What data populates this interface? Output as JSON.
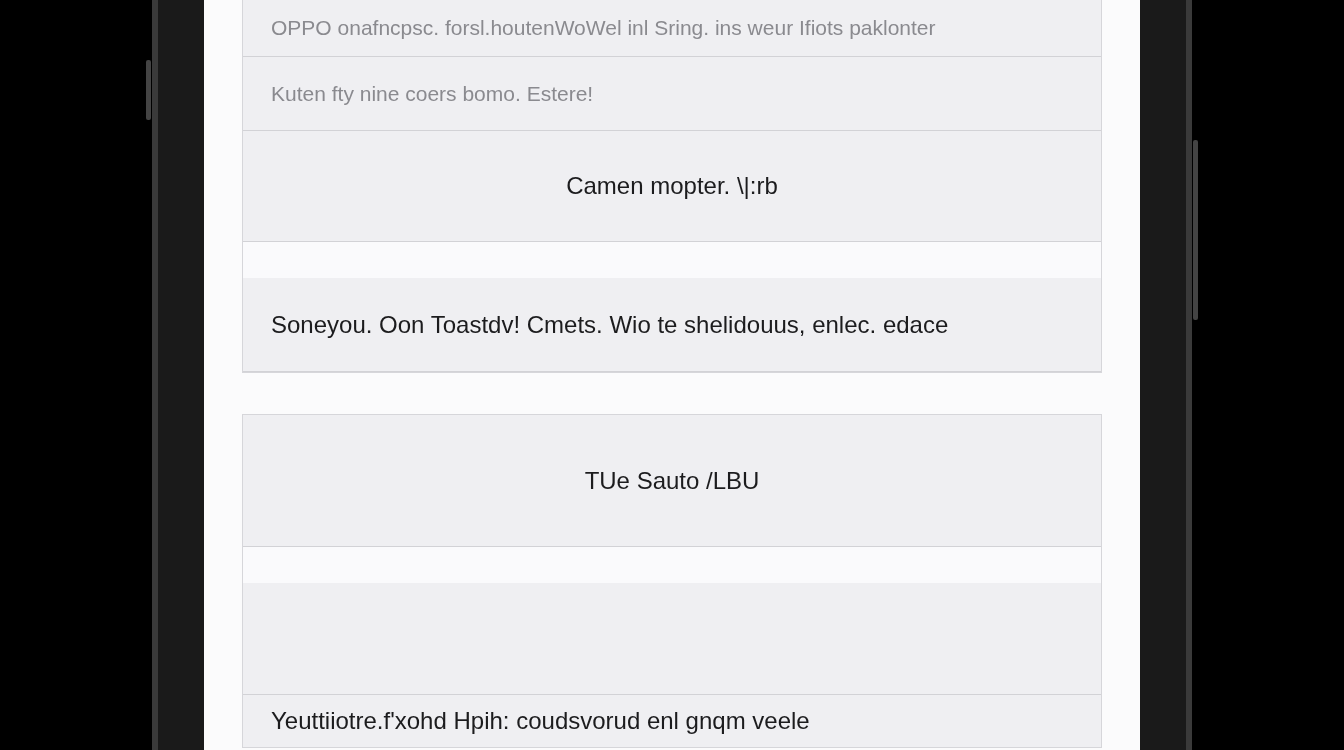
{
  "groups": [
    {
      "rows": [
        {
          "kind": "muted",
          "text": "OPPO onafncpsc. forsl.houtenWoWel inl Sring. ins weur Ifiots paklonter"
        },
        {
          "kind": "muted",
          "text": "Kuten fty nine coers bomo. Estere!"
        },
        {
          "kind": "centered",
          "text": "Camen mopter. \\|:rb"
        },
        {
          "kind": "spacer"
        },
        {
          "kind": "plain",
          "text": "Soneyou. Oon Toastdv! Cmets. Wio te shelidouus, enlec. edace"
        }
      ]
    },
    {
      "rows": [
        {
          "kind": "centered",
          "text": "TUe Sauto /LBU"
        },
        {
          "kind": "spacer"
        },
        {
          "kind": "empty"
        },
        {
          "kind": "plain",
          "text": "Yeuttiiotre.f'xohd Hpih: coudsvorud enl gnqm veele"
        }
      ]
    }
  ]
}
